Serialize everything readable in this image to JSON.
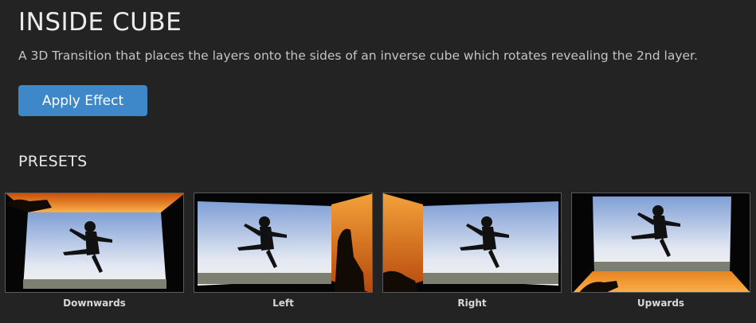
{
  "effect": {
    "title": "INSIDE CUBE",
    "description": "A 3D Transition that places the layers onto the sides of an inverse cube which rotates revealing the 2nd layer.",
    "apply_label": "Apply Effect"
  },
  "presets": {
    "heading": "PRESETS",
    "items": [
      {
        "label": "Downwards",
        "side": "top"
      },
      {
        "label": "Left",
        "side": "right"
      },
      {
        "label": "Right",
        "side": "left"
      },
      {
        "label": "Upwards",
        "side": "bottom"
      }
    ]
  },
  "colors": {
    "background": "#232323",
    "accent": "#3e87c9",
    "sky": "#dfe6f3",
    "sunset": "#f0902a"
  }
}
